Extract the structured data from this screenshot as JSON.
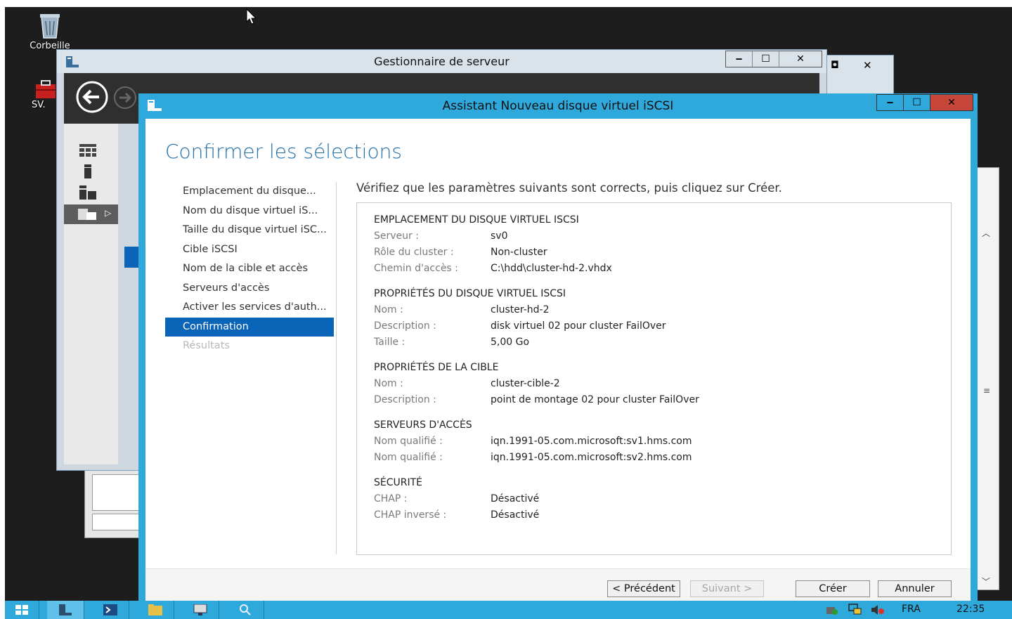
{
  "desktop": {
    "icons": [
      {
        "label": "Corbeille",
        "icon": "recycle-bin-icon"
      },
      {
        "label": "SV.",
        "icon": "toolbox-icon"
      }
    ]
  },
  "server_manager": {
    "title": "Gestionnaire de serveur",
    "caption": {
      "minimize": "‒",
      "maximize": "☐",
      "close": "✕"
    }
  },
  "wizard": {
    "title": "Assistant Nouveau disque virtuel iSCSI",
    "caption": {
      "minimize": "‒",
      "maximize": "☐",
      "close": "✕"
    },
    "heading": "Confirmer les sélections",
    "steps": [
      {
        "label": "Emplacement du disque..."
      },
      {
        "label": "Nom du disque virtuel iS..."
      },
      {
        "label": "Taille du disque virtuel iSC..."
      },
      {
        "label": "Cible iSCSI"
      },
      {
        "label": "Nom de la cible et accès"
      },
      {
        "label": "Serveurs d'accès"
      },
      {
        "label": "Activer les services d'auth..."
      },
      {
        "label": "Confirmation",
        "selected": true
      },
      {
        "label": "Résultats",
        "disabled": true
      }
    ],
    "intro": "Vérifiez que les paramètres suivants sont corrects, puis cliquez sur Créer.",
    "sections": [
      {
        "title": "EMPLACEMENT DU DISQUE VIRTUEL ISCSI",
        "rows": [
          {
            "key": "Serveur :",
            "value": "sv0"
          },
          {
            "key": "Rôle du cluster :",
            "value": "Non-cluster"
          },
          {
            "key": "Chemin d'accès :",
            "value": "C:\\hdd\\cluster-hd-2.vhdx"
          }
        ]
      },
      {
        "title": "PROPRIÉTÉS DU DISQUE VIRTUEL ISCSI",
        "rows": [
          {
            "key": "Nom :",
            "value": "cluster-hd-2"
          },
          {
            "key": "Description :",
            "value": "disk virtuel 02 pour cluster FailOver"
          },
          {
            "key": "Taille :",
            "value": "5,00 Go"
          }
        ]
      },
      {
        "title": "PROPRIÉTÉS DE LA CIBLE",
        "rows": [
          {
            "key": "Nom :",
            "value": "cluster-cible-2"
          },
          {
            "key": "Description :",
            "value": "point de montage 02 pour cluster FailOver"
          }
        ]
      },
      {
        "title": "SERVEURS D'ACCÈS",
        "rows": [
          {
            "key": "Nom qualifié :",
            "value": "iqn.1991-05.com.microsoft:sv1.hms.com"
          },
          {
            "key": "Nom qualifié :",
            "value": "iqn.1991-05.com.microsoft:sv2.hms.com"
          }
        ]
      },
      {
        "title": "SÉCURITÉ",
        "rows": [
          {
            "key": "CHAP :",
            "value": "Désactivé"
          },
          {
            "key": "CHAP inversé :",
            "value": "Désactivé"
          }
        ]
      }
    ],
    "buttons": {
      "previous": "< Précédent",
      "next": "Suivant >",
      "create": "Créer",
      "cancel": "Annuler"
    }
  },
  "taskbar": {
    "language": "FRA",
    "time": "22:35"
  },
  "colors": {
    "accent": "#2fa9dc",
    "selection": "#0a64b7",
    "heading": "#1f6fa8",
    "close": "#c7463a"
  }
}
